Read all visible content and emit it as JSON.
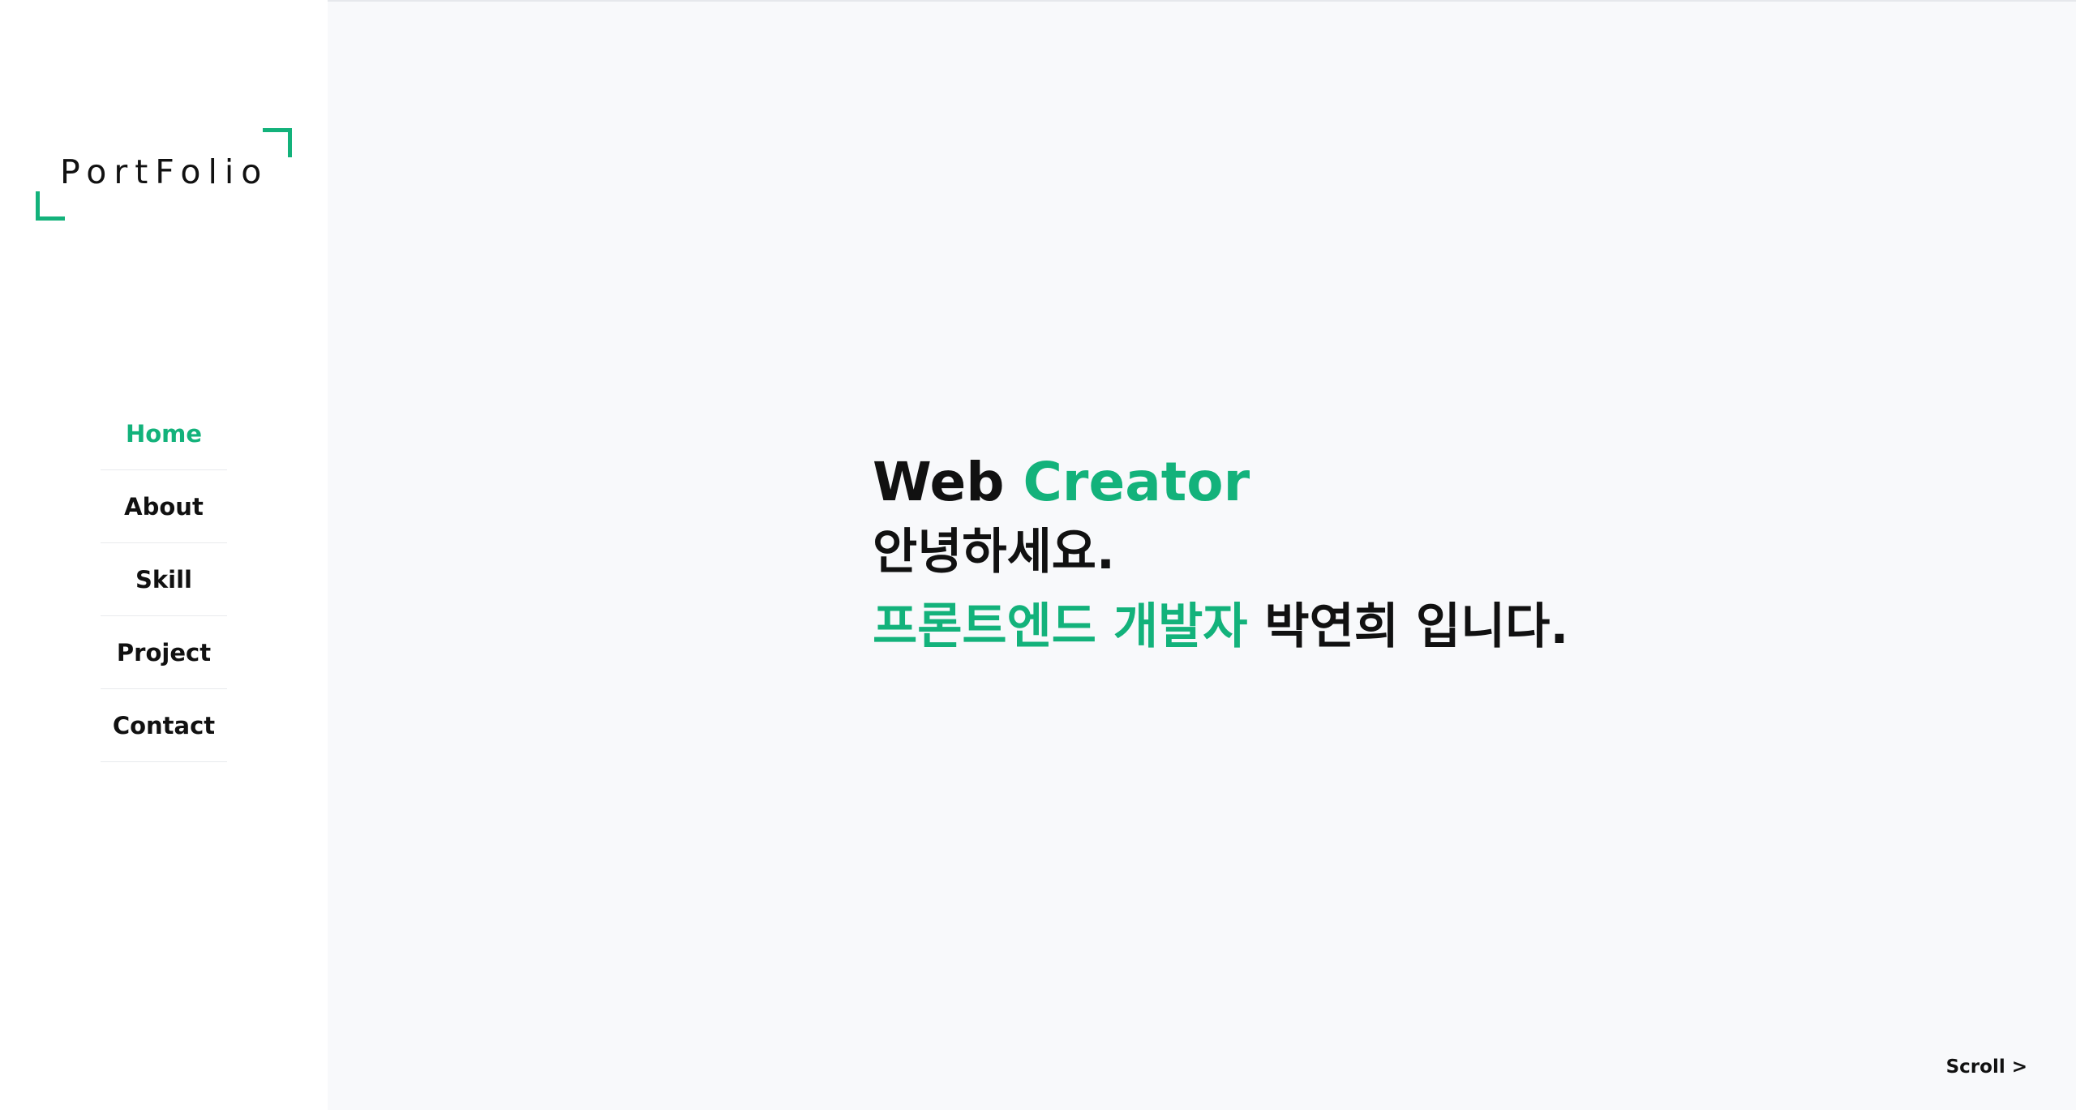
{
  "logo": {
    "text": "PortFolio"
  },
  "nav": {
    "items": [
      {
        "label": "Home",
        "active": true
      },
      {
        "label": "About",
        "active": false
      },
      {
        "label": "Skill",
        "active": false
      },
      {
        "label": "Project",
        "active": false
      },
      {
        "label": "Contact",
        "active": false
      }
    ]
  },
  "hero": {
    "title_part1": "Web",
    "title_part2": "Creator",
    "greeting": "안녕하세요.",
    "role": "프론트엔드 개발자",
    "name_suffix": "박연희 입니다."
  },
  "scroll": {
    "label": "Scroll >"
  },
  "colors": {
    "accent": "#13b27b",
    "text": "#111111",
    "background": "#f8f9fb",
    "sidebar": "#ffffff"
  }
}
